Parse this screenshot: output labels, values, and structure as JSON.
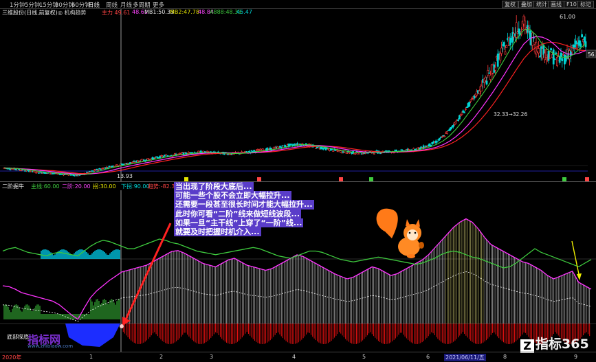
{
  "toolbar": {
    "timeframes": [
      "1分钟",
      "5分钟",
      "15分钟",
      "30分钟",
      "60分钟",
      "日线",
      "周线",
      "月线",
      "多周期",
      "更多"
    ],
    "active_timeframe": "日线",
    "right_buttons": [
      "复权",
      "叠加",
      "统计",
      "画线",
      "F10",
      "标记"
    ]
  },
  "info": {
    "title": "三维股份(日线,前复权)",
    "indicator": "◎ 机构趋势",
    "ma_main": "主力 49.61",
    "ma_main2": "48.61",
    "ma1": "MB1:50.33",
    "ma2": "MB2:47.78",
    "ma3": "48.84",
    "ma4": "A888:48.33",
    "ma5": "45.47"
  },
  "price_labels": {
    "high": "61.00",
    "low": "13.93",
    "mid": "32.33→32.26",
    "right_tag": "56."
  },
  "indicator_bar": {
    "name": "二阶掘牛",
    "v1": "主线:60.00",
    "v2": "二阶:20.00",
    "v3": "拐:30.00",
    "v4": "下拐:90.00",
    "v5": "趋势:-82.37"
  },
  "annotation": {
    "lines": [
      "当出现了阶段大底后...",
      "可能一些个股不会立即大幅拉升...",
      "还需要一段甚至很长时间才能大幅拉升...",
      "此时你可看“二阶”线来做短线波段...",
      "如果一旦“主干线”上穿了“一阶”线...",
      "就要及时把握时机介入..."
    ]
  },
  "watermark": {
    "left_label": "底部探底",
    "brand": "指标网",
    "brand_url": "www.zhibiaow.com",
    "logo": "指标365",
    "logo_mark": "Z"
  },
  "axis": {
    "labels": [
      "2020年",
      "1",
      "2",
      "3",
      "4",
      "5",
      "6",
      "2021/06/11/五",
      "8",
      "9"
    ]
  },
  "chart_data": {
    "type": "candlestick",
    "price_range": [
      13.93,
      61.0
    ],
    "price_trend": [
      16.2,
      16.0,
      15.8,
      15.6,
      15.3,
      15.0,
      14.8,
      14.6,
      14.5,
      14.3,
      14.2,
      14.0,
      13.93,
      14.4,
      15.0,
      15.6,
      16.1,
      16.5,
      16.9,
      17.2,
      17.6,
      18.0,
      18.4,
      18.7,
      19.1,
      19.5,
      19.9,
      20.2,
      20.4,
      20.6,
      20.8,
      21.0,
      21.1,
      21.0,
      20.9,
      20.8,
      20.7,
      20.6,
      20.8,
      21.0,
      21.3,
      21.6,
      21.8,
      22.0,
      22.4,
      22.8,
      23.2,
      23.4,
      23.6,
      23.3,
      22.9,
      22.6,
      22.2,
      21.8,
      21.5,
      21.2,
      21.0,
      20.9,
      20.9,
      21.0,
      21.1,
      21.2,
      21.3,
      21.3,
      21.4,
      21.6,
      21.8,
      22.2,
      22.8,
      23.5,
      24.5,
      26.0,
      28.0,
      30.5,
      33.0,
      35.6,
      38.2,
      41.0,
      44.0,
      47.0,
      50.5,
      53.8,
      57.0,
      59.5,
      61.0,
      57.5,
      54.0,
      52.5,
      51.8,
      50.5,
      49.8,
      51.5,
      53.2,
      55.0,
      56.3
    ],
    "indicator_first_order": [
      58,
      60,
      61,
      59,
      57,
      56,
      55,
      54,
      56,
      57,
      56,
      55,
      54,
      58,
      62,
      65,
      67,
      66,
      64,
      62,
      60,
      60,
      62,
      64,
      66,
      68,
      67,
      65,
      64,
      62,
      60,
      58,
      57,
      56,
      55,
      56,
      57,
      58,
      59,
      60,
      61,
      60,
      58,
      56,
      54,
      53,
      52,
      54,
      56,
      58,
      58,
      57,
      55,
      53,
      51,
      50,
      49,
      50,
      51,
      52,
      53,
      52,
      51,
      50,
      49,
      48,
      47,
      48,
      50,
      52,
      55,
      57,
      58,
      57,
      55,
      53,
      52,
      50,
      48,
      46,
      44,
      45,
      48,
      52,
      56,
      60,
      57,
      55,
      53,
      51,
      49,
      47,
      45,
      48,
      51
    ],
    "indicator_second_order": [
      44,
      43,
      40,
      36,
      34,
      32,
      30,
      28,
      26,
      22,
      16,
      10,
      5,
      18,
      30,
      38,
      44,
      50,
      55,
      60,
      62,
      64,
      66,
      68,
      72,
      76,
      80,
      84,
      85,
      82,
      78,
      74,
      70,
      68,
      66,
      70,
      74,
      76,
      72,
      68,
      66,
      64,
      62,
      64,
      68,
      72,
      76,
      80,
      78,
      74,
      70,
      66,
      62,
      58,
      55,
      52,
      54,
      58,
      62,
      66,
      64,
      60,
      56,
      58,
      62,
      66,
      70,
      74,
      80,
      88,
      96,
      104,
      112,
      118,
      122,
      118,
      110,
      100,
      92,
      88,
      84,
      80,
      76,
      72,
      70,
      66,
      62,
      56,
      52,
      55,
      58,
      61,
      48,
      44,
      40
    ]
  },
  "colors": {
    "background": "#000000",
    "up": "#ff3b3b",
    "down": "#00d5d5",
    "ma_magenta": "#ff33ff",
    "ma_green": "#3ecb3e",
    "ma_yellow": "#e6e600",
    "annot_bg": "#5a3dc9"
  }
}
